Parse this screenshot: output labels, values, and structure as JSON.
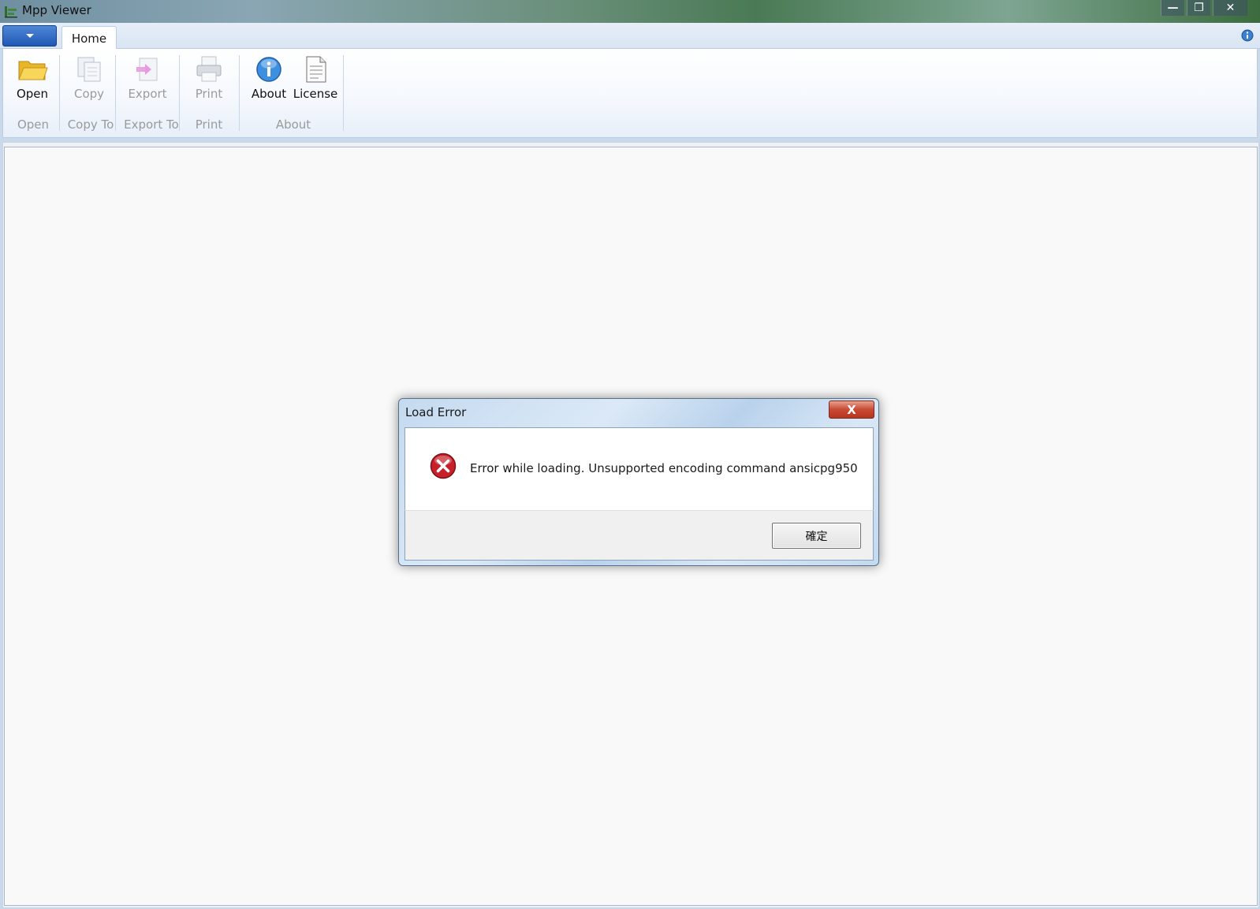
{
  "window": {
    "title": "Mpp Viewer",
    "controls": {
      "minimize": "—",
      "maximize": "❐",
      "close": "✕"
    }
  },
  "tabs": [
    {
      "label": "Home",
      "active": true
    }
  ],
  "ribbon": {
    "buttons": {
      "open": {
        "label": "Open",
        "icon": "folder-icon",
        "enabled": true
      },
      "copy": {
        "label": "Copy",
        "icon": "copy-icon",
        "enabled": false
      },
      "export": {
        "label": "Export",
        "icon": "export-icon",
        "enabled": false
      },
      "print": {
        "label": "Print",
        "icon": "printer-icon",
        "enabled": false
      },
      "about": {
        "label": "About",
        "icon": "info-icon",
        "enabled": true
      },
      "license": {
        "label": "License",
        "icon": "document-icon",
        "enabled": true
      }
    },
    "groups": {
      "open": "Open",
      "copy_to": "Copy To",
      "export_to": "Export To",
      "print": "Print",
      "about": "About"
    }
  },
  "dialog": {
    "title": "Load Error",
    "close_label": "X",
    "icon": "error-icon",
    "message": "Error while loading. Unsupported encoding command ansicpg950",
    "ok_label": "確定"
  },
  "colors": {
    "accent": "#1f57b5",
    "error": "#c8202a",
    "ribbon_border": "#b9cde5"
  }
}
